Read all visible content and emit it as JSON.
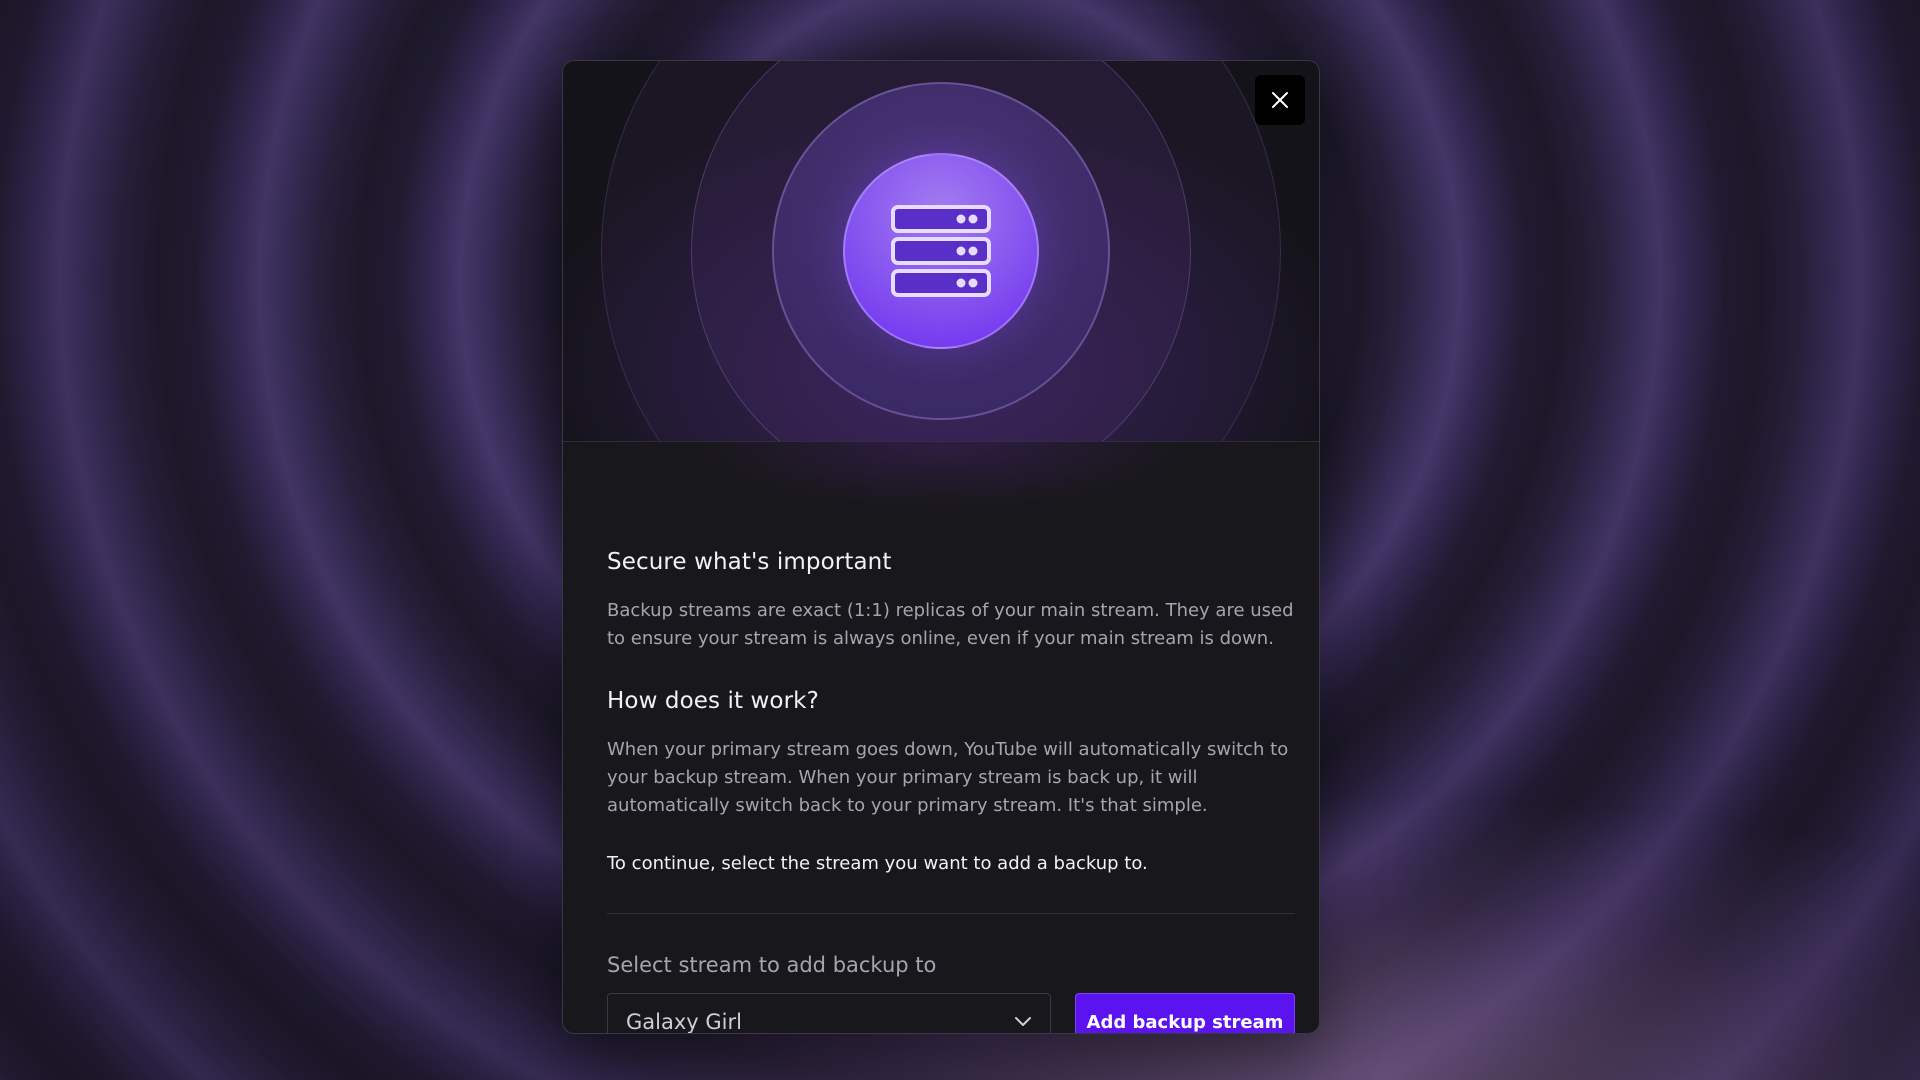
{
  "modal": {
    "close_icon": "close-icon",
    "hero_icon": "server-stack-icon",
    "sections": {
      "secure": {
        "title": "Secure what's important",
        "body": "Backup streams are exact (1:1) replicas of your main stream. They are used to ensure your stream is always online, even if your main stream is down."
      },
      "how": {
        "title": "How does it work?",
        "body": "When your primary stream goes down, YouTube will automatically switch to your backup stream. When your primary stream is back up, it will automatically switch back to your primary stream. It's that simple."
      }
    },
    "continue_text": "To continue, select the stream you want to add a backup to.",
    "select": {
      "label": "Select stream to add backup to",
      "value": "Galaxy Girl",
      "icon": "chevron-down-icon"
    },
    "add_button_label": "Add backup stream"
  },
  "colors": {
    "accent": "#5b14f0",
    "modal_bg": "#18171b",
    "orb": "#8452ef"
  }
}
